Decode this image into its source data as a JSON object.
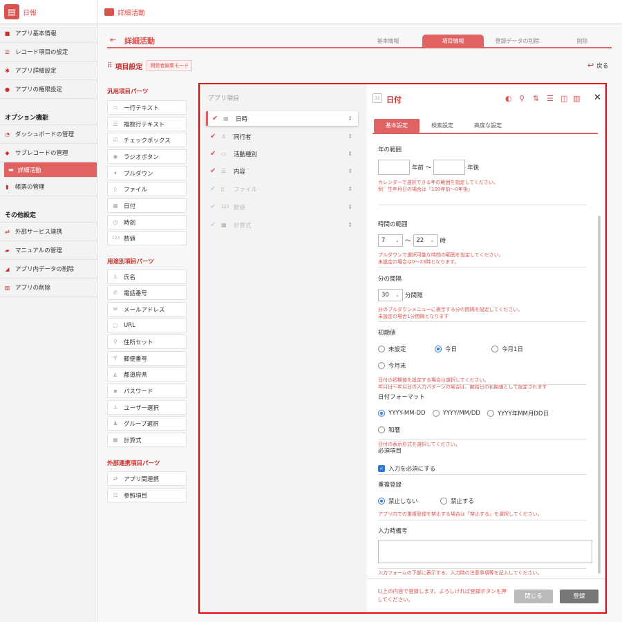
{
  "app": {
    "title": "日報"
  },
  "sidebar": {
    "items": [
      {
        "label": "アプリ基本情報",
        "icon": "info-icon"
      },
      {
        "label": "レコード項目の設定",
        "icon": "list-icon"
      },
      {
        "label": "アプリ詳細設定",
        "icon": "gear-icon"
      },
      {
        "label": "アプリの権限設定",
        "icon": "users-icon"
      }
    ],
    "option_section": "オプション機能",
    "option_items": [
      {
        "label": "ダッシュボードの管理",
        "icon": "dashboard-icon"
      },
      {
        "label": "サブレコードの管理",
        "icon": "layers-icon"
      }
    ],
    "active_sub": "詳細活動",
    "option_items2": [
      {
        "label": "帳票の管理",
        "icon": "report-icon"
      }
    ],
    "other_section": "その他設定",
    "other_items": [
      {
        "label": "外部サービス連携",
        "icon": "link-icon"
      },
      {
        "label": "マニュアルの管理",
        "icon": "book-icon"
      },
      {
        "label": "アプリ内データの削除",
        "icon": "eraser-icon"
      },
      {
        "label": "アプリの削除",
        "icon": "trash-icon"
      }
    ]
  },
  "topbar": {
    "title": "詳細活動"
  },
  "page": {
    "title": "詳細活動",
    "tabs": [
      "基本情報",
      "項目情報",
      "登録データの削除",
      "削除"
    ],
    "active_tab": "項目情報",
    "item_settings_label": "項目設定",
    "mode_badge": "開発者編集モード",
    "back_label": "戻る"
  },
  "parts": {
    "general_title": "汎用項目パーツ",
    "general": [
      "一行テキスト",
      "複数行テキスト",
      "チェックボックス",
      "ラジオボタン",
      "プルダウン",
      "ファイル",
      "日付",
      "時刻",
      "数値"
    ],
    "usage_title": "用途別項目パーツ",
    "usage": [
      "氏名",
      "電話番号",
      "メールアドレス",
      "URL",
      "住所セット",
      "郵便番号",
      "都道府県",
      "パスワード",
      "ユーザー選択",
      "グループ選択",
      "計算式"
    ],
    "external_title": "外部連携項目パーツ",
    "external": [
      "アプリ間連携",
      "参照項目"
    ]
  },
  "app_fields": {
    "header": "アプリ項目",
    "items": [
      {
        "label": "日時",
        "checked": true,
        "enabled": true
      },
      {
        "label": "同行者",
        "checked": true,
        "enabled": true
      },
      {
        "label": "活動種別",
        "checked": true,
        "enabled": true
      },
      {
        "label": "内容",
        "checked": true,
        "enabled": true
      },
      {
        "label": "ファイル",
        "checked": true,
        "enabled": false
      },
      {
        "label": "数値",
        "checked": true,
        "enabled": false
      },
      {
        "label": "計算式",
        "checked": true,
        "enabled": false
      }
    ]
  },
  "detail": {
    "calendar_icon_text": "31",
    "title": "日付",
    "tabs": [
      "基本設定",
      "検索設定",
      "高度な設定"
    ],
    "active_tab": "基本設定",
    "year_range": {
      "title": "年の範囲",
      "before": "年前 〜",
      "after": "年後",
      "help1": "カレンダーで選択できる年の範囲を指定してください。",
      "help2": "例：生年月日の場合は「100年前〜0年後」"
    },
    "time_range": {
      "title": "時間の範囲",
      "from": "7",
      "sep": "〜",
      "to": "22",
      "unit": "時",
      "help1": "プルダウンで選択可能な時間の範囲を設定してください。",
      "help2": "未設定の場合は0〜23時となります。"
    },
    "minute_step": {
      "title": "分の間隔",
      "value": "30",
      "unit": "分間隔",
      "help1": "分のプルダウンメニューに表示する分の間隔を設定してください。",
      "help2": "未設定の場合1分間隔となります"
    },
    "initial": {
      "title": "初期値",
      "options": [
        "未設定",
        "今日",
        "今月1日",
        "今月末"
      ],
      "selected": "今日",
      "help1": "日付の初期値を設定する場合は選択してください。",
      "help2": "年月日〜年月日の入力パターンの場合は、開始日の初期値として設定されます"
    },
    "format": {
      "title": "日付フォーマット",
      "options": [
        "YYYY-MM-DD",
        "YYYY/MM/DD",
        "YYYY年MM月DD日",
        "和暦"
      ],
      "selected": "YYYY-MM-DD",
      "help": "日付の表示形式を選択してください。"
    },
    "required": {
      "title": "必須項目",
      "label": "入力を必須にする",
      "checked": true
    },
    "duplicate": {
      "title": "重複登録",
      "options": [
        "禁止しない",
        "禁止する"
      ],
      "selected": "禁止しない",
      "help": "アプリ内での重複登録を禁止する場合は「禁止する」を選択してください。"
    },
    "note": {
      "title": "入力時備考",
      "value": "",
      "help": "入力フォームの下部に表示する、入力時の注意事項等を記入してください。"
    },
    "footer": {
      "message": "以上の内容で登録します。よろしければ登録ボタンを押してください。",
      "close": "閉じる",
      "save": "登録"
    }
  },
  "colors": {
    "accent": "#d9534f",
    "active": "#e06262",
    "frame": "#ee0000",
    "radio": "#2a77d6"
  }
}
